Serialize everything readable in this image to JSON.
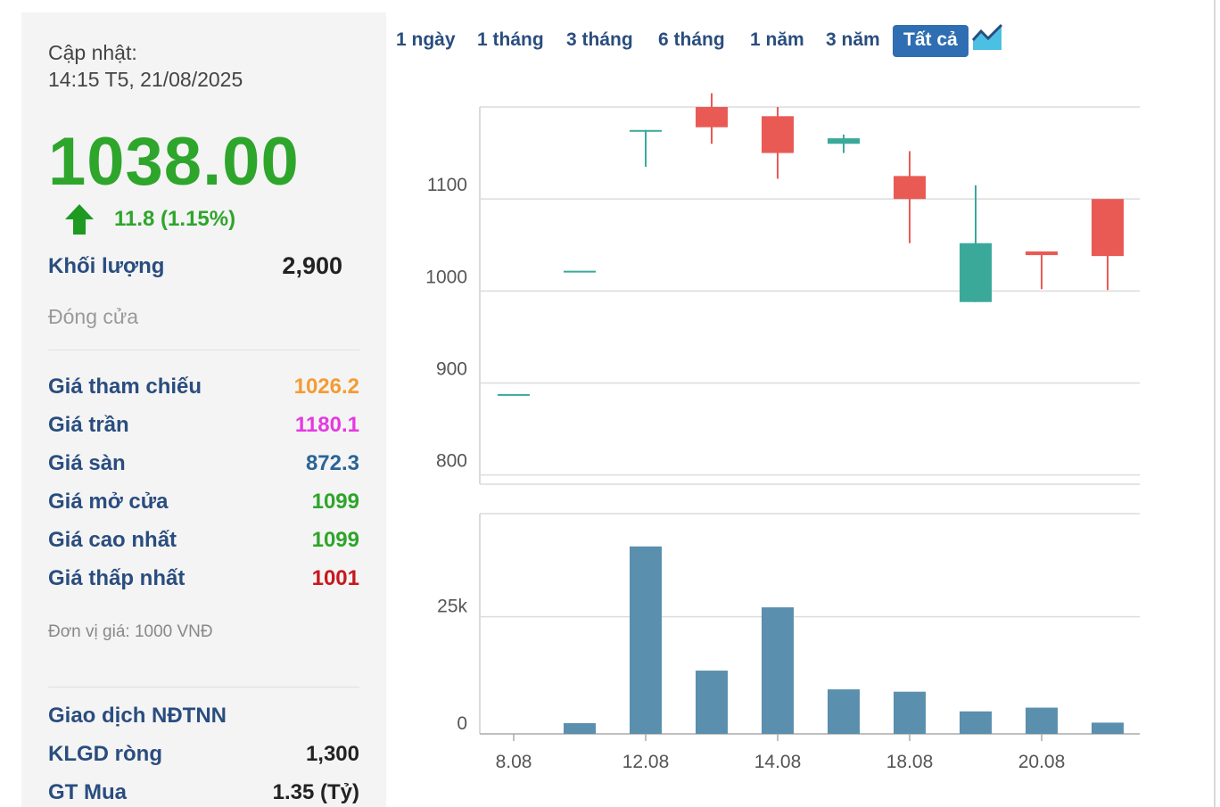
{
  "summary": {
    "updated_label": "Cập nhật:",
    "updated_time": "14:15 T5, 21/08/2025",
    "price": "1038.00",
    "change": "11.8 (1.15%)",
    "volume_label": "Khối lượng",
    "volume_value": "2,900",
    "status": "Đóng cửa",
    "rows": [
      {
        "label": "Giá tham chiếu",
        "value": "1026.2",
        "color": "#f39c34"
      },
      {
        "label": "Giá trần",
        "value": "1180.1",
        "color": "#e43ae0"
      },
      {
        "label": "Giá sàn",
        "value": "872.3",
        "color": "#2a6496"
      },
      {
        "label": "Giá mở cửa",
        "value": "1099",
        "color": "#2ea52b"
      },
      {
        "label": "Giá cao nhất",
        "value": "1099",
        "color": "#2ea52b"
      },
      {
        "label": "Giá thấp nhất",
        "value": "1001",
        "color": "#c9171e"
      }
    ],
    "unit_note": "Đơn vị giá: 1000 VNĐ",
    "foreign_title": "Giao dịch NĐTNN",
    "foreign_rows": [
      {
        "label": "KLGD ròng",
        "value": "1,300"
      },
      {
        "label": "GT Mua",
        "value": "1.35 (Tỷ)"
      }
    ]
  },
  "tabs": {
    "items": [
      "1 ngày",
      "1 tháng",
      "3 tháng",
      "6 tháng",
      "1 năm",
      "3 năm",
      "Tất cả"
    ],
    "active": "Tất cả"
  },
  "chart_data": {
    "type": "candlestick",
    "price_axis": {
      "ticks": [
        800,
        900,
        1000,
        1100
      ],
      "range": [
        790,
        1200
      ]
    },
    "volume_axis": {
      "ticks": [
        "0",
        "25k"
      ],
      "range": [
        0,
        47000
      ]
    },
    "x_ticks": [
      "8.08",
      "12.08",
      "14.08",
      "18.08",
      "20.08"
    ],
    "up_color": "#3aa99a",
    "down_color": "#e95a54",
    "volume_color": "#5b8fae",
    "candles": [
      {
        "open": 888,
        "close": 888,
        "high": 888,
        "low": 888,
        "volume": 0
      },
      {
        "open": 1022,
        "close": 1022,
        "high": 1022,
        "low": 1022,
        "volume": 2300
      },
      {
        "open": 1175,
        "close": 1175,
        "high": 1175,
        "low": 1135,
        "volume": 40000
      },
      {
        "open": 1215,
        "close": 1178,
        "high": 1215,
        "low": 1160,
        "volume": 13500
      },
      {
        "open": 1190,
        "close": 1150,
        "high": 1200,
        "low": 1122,
        "volume": 27000
      },
      {
        "open": 1160,
        "close": 1166,
        "high": 1170,
        "low": 1150,
        "volume": 9500
      },
      {
        "open": 1125,
        "close": 1100,
        "high": 1152,
        "low": 1052,
        "volume": 9000
      },
      {
        "open": 988,
        "close": 1052,
        "high": 1115,
        "low": 988,
        "volume": 4800
      },
      {
        "open": 1043,
        "close": 1039,
        "high": 1043,
        "low": 1002,
        "volume": 5600
      },
      {
        "open": 1100,
        "close": 1038,
        "high": 1100,
        "low": 1001,
        "volume": 2400
      }
    ]
  }
}
